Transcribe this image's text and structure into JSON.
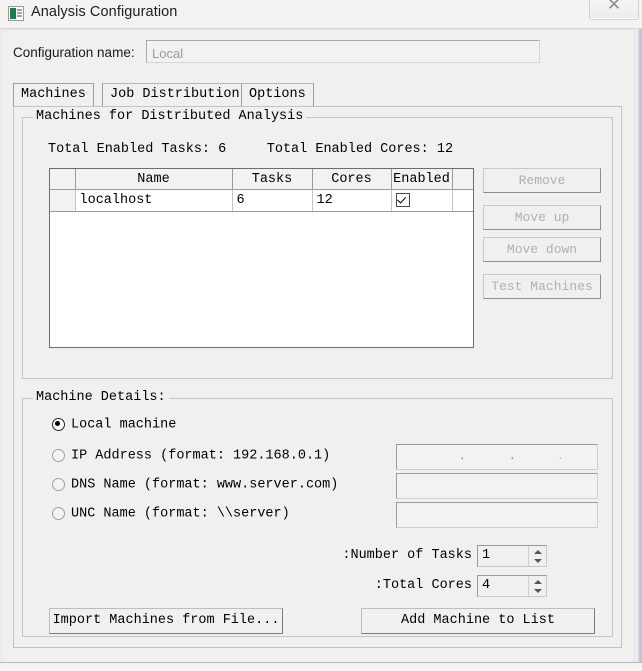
{
  "window": {
    "title": "Analysis Configuration",
    "app_icon": "analysis-config-icon",
    "close_label": "✕"
  },
  "config": {
    "name_label": "Configuration name:",
    "name_value": "",
    "name_placeholder": "Local"
  },
  "tabs": [
    {
      "label": "Machines",
      "active": true
    },
    {
      "label": "Job Distribution",
      "active": false
    },
    {
      "label": "Options",
      "active": false
    }
  ],
  "machines_group": {
    "legend": "Machines for Distributed Analysis",
    "totals": "Total Enabled Tasks: 6     Total Enabled Cores: 12",
    "totals_parts": {
      "tasks_label": "Total Enabled Tasks:",
      "tasks_value": "6",
      "cores_label": "Total Enabled Cores:",
      "cores_value": "12"
    },
    "table": {
      "columns": [
        "",
        "Name",
        "Tasks",
        "Cores",
        "Enabled",
        ""
      ],
      "rows": [
        {
          "handle": "",
          "name": "localhost",
          "tasks": "6",
          "cores": "12",
          "enabled": true
        }
      ]
    },
    "buttons": [
      {
        "label": "Remove",
        "enabled": false
      },
      {
        "label": "Move up",
        "enabled": false
      },
      {
        "label": "Move down",
        "enabled": false
      },
      {
        "label": "Test Machines",
        "enabled": false
      }
    ]
  },
  "details_group": {
    "legend": "Machine Details:",
    "radios": [
      {
        "label": "Local machine",
        "selected": true
      },
      {
        "label": "IP Address (format: 192.168.0.1)",
        "selected": false
      },
      {
        "label": "DNS Name (format: www.server.com)",
        "selected": false
      },
      {
        "label": "UNC Name (format: \\\\server)",
        "selected": false
      }
    ],
    "fields": [
      {
        "name": "ip-address-field",
        "value": "",
        "separators": [
          ".",
          ".",
          "."
        ]
      },
      {
        "name": "dns-name-field",
        "value": ""
      },
      {
        "name": "unc-name-field",
        "value": ""
      }
    ],
    "spinners": [
      {
        "label": "Number of Tasks:",
        "value": "1"
      },
      {
        "label": "Total Cores:",
        "value": "4"
      }
    ]
  },
  "footer": {
    "import_label": "Import Machines from File...",
    "add_label": "Add Machine to List"
  }
}
